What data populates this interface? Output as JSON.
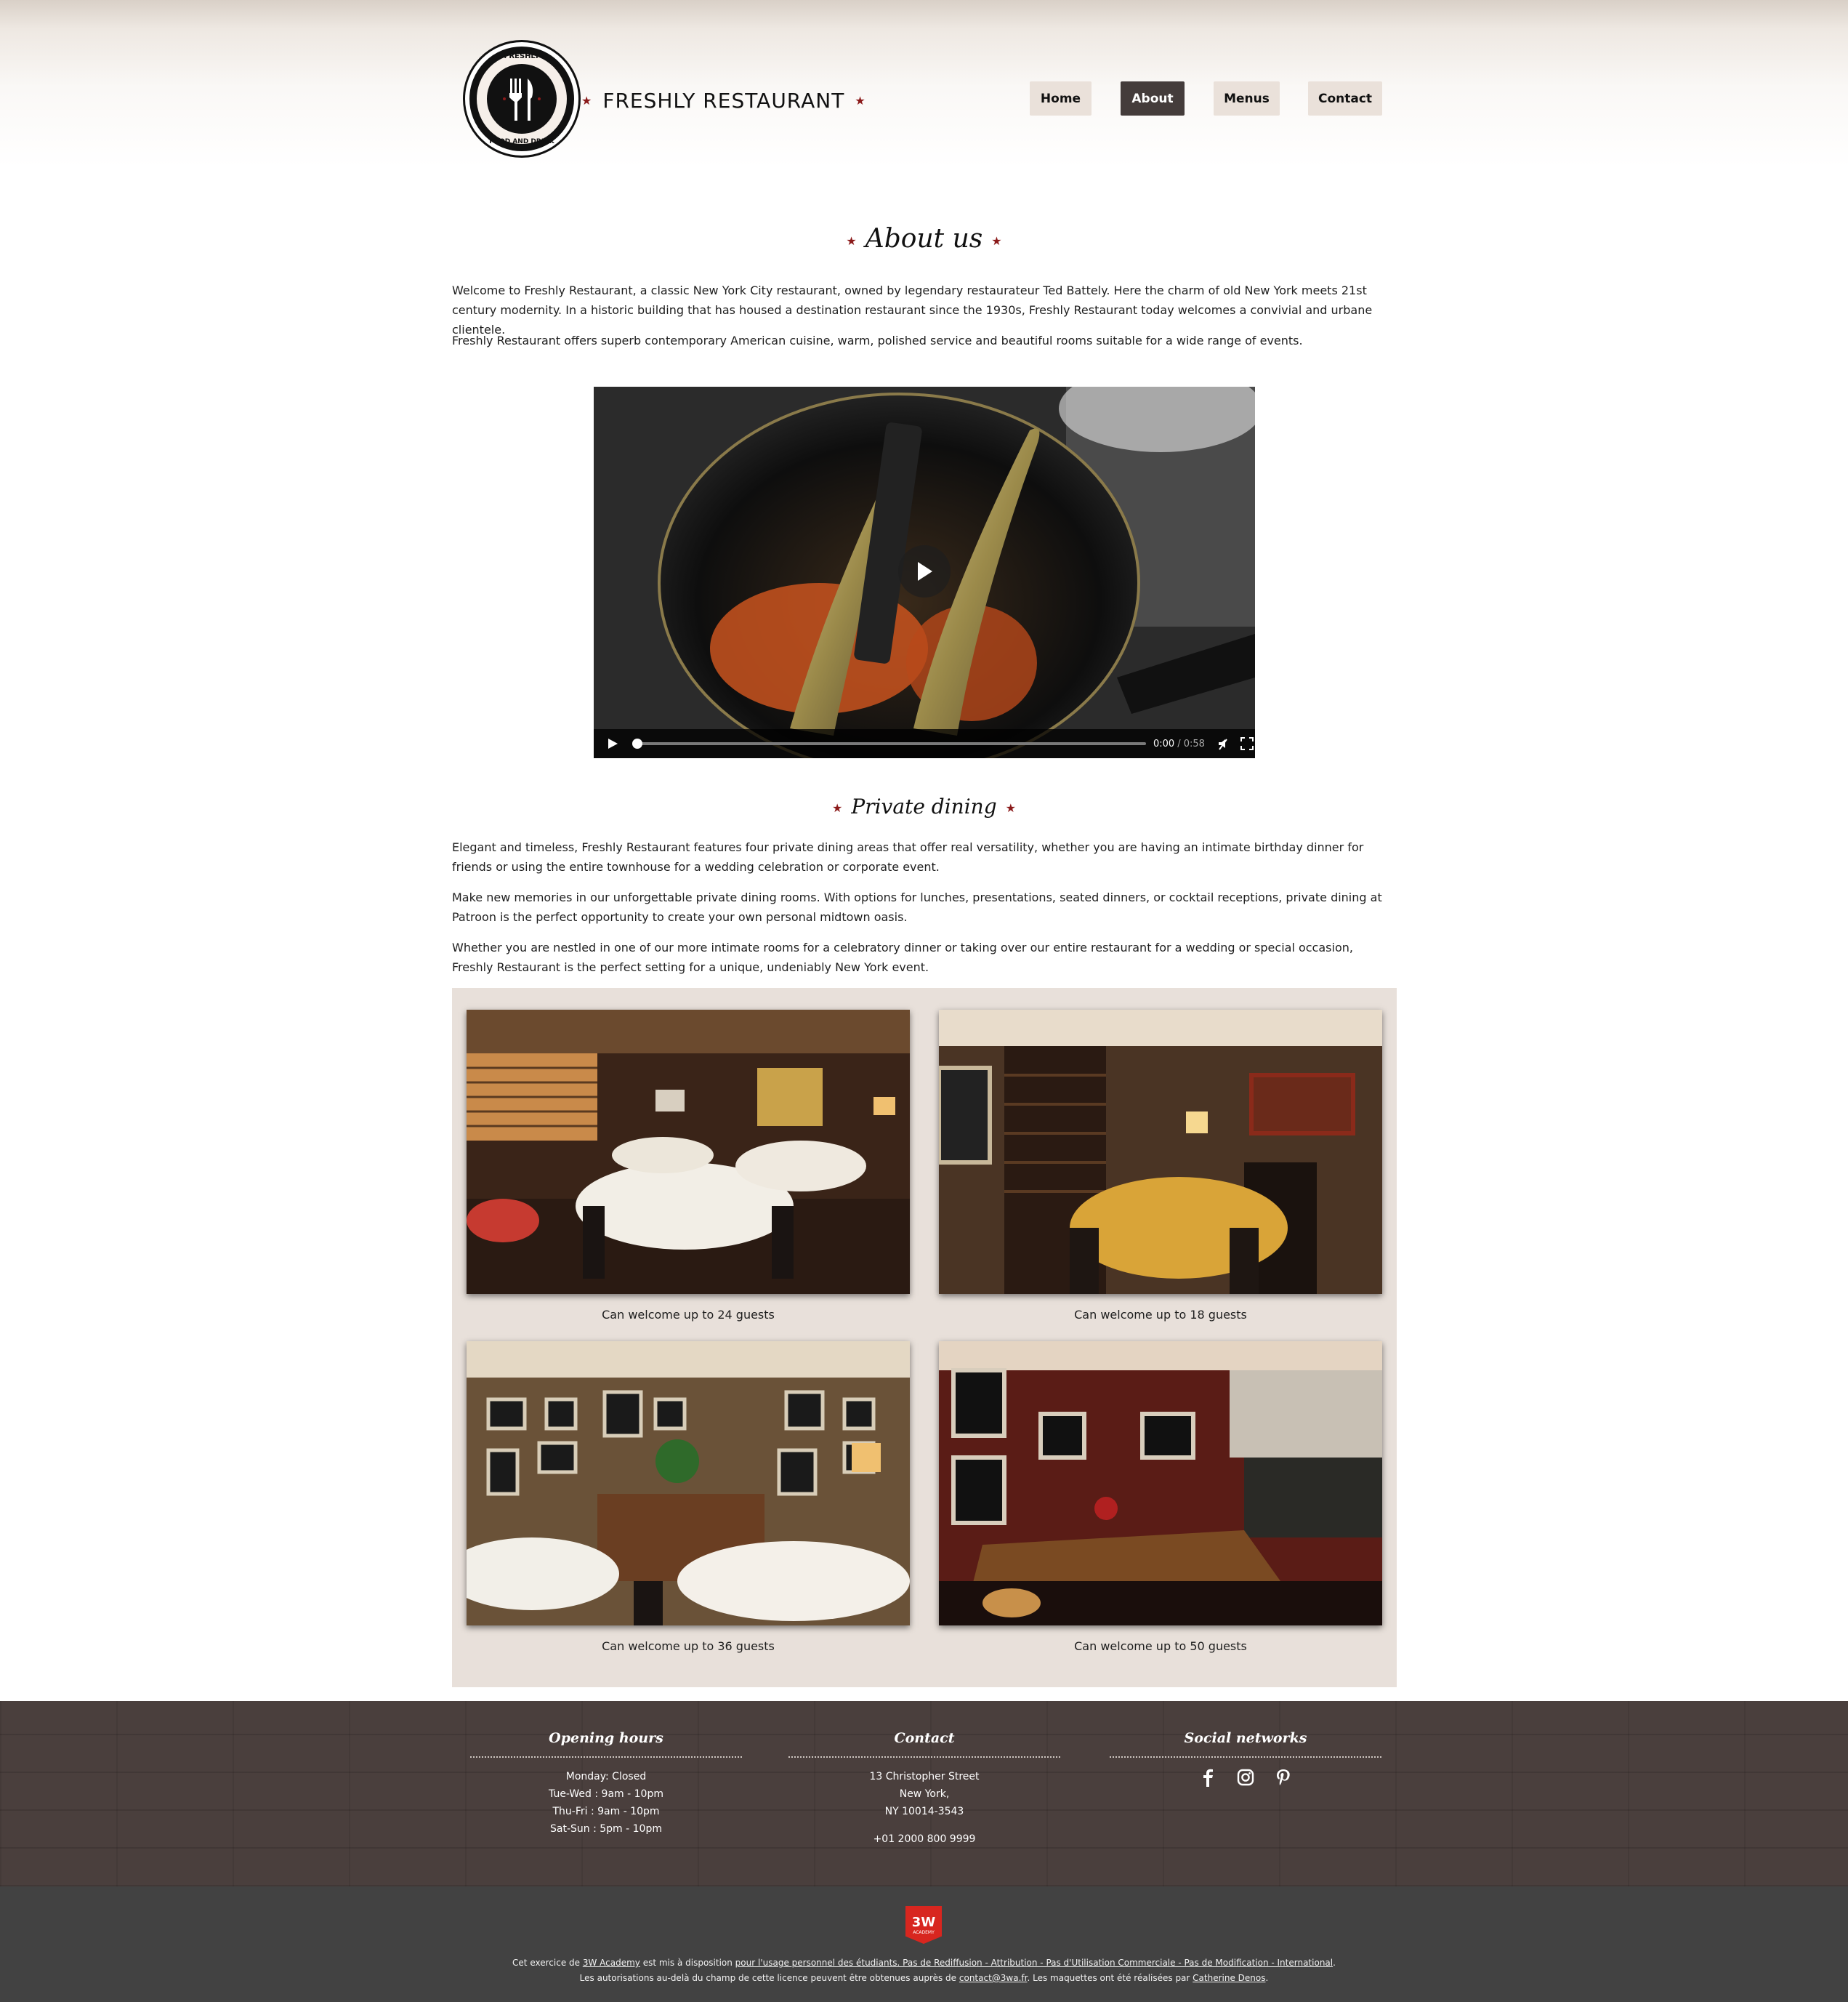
{
  "header": {
    "logo": {
      "top_text": "FRESHLY",
      "bottom_text": "FOOD AND DRINK"
    },
    "brand": "FRESHLY RESTAURANT",
    "nav": [
      "Home",
      "About",
      "Menus",
      "Contact"
    ],
    "active_nav": "About"
  },
  "about": {
    "title": "About us",
    "paragraphs": [
      "Welcome to Freshly Restaurant, a classic New York City restaurant, owned by legendary restaurateur Ted Battely. Here the charm of old New York meets 21st century modernity. In a historic building that has housed a destination restaurant since the 1930s, Freshly Restaurant today welcomes a convivial and urbane clientele.",
      "Freshly Restaurant offers superb contemporary American cuisine, warm, polished service and beautiful rooms suitable for a wide range of events."
    ]
  },
  "video": {
    "current": "0:00",
    "duration": "/ 0:58",
    "progress": 0.0
  },
  "private": {
    "title": "Private dining",
    "paragraphs": [
      "Elegant and timeless, Freshly Restaurant features four private dining areas that offer real versatility, whether you are having an intimate birthday dinner for friends or using the entire townhouse for a wedding celebration or corporate event.",
      "Make new memories in our unforgettable private dining rooms. With options for lunches, presentations, seated dinners, or cocktail receptions, private dining at Patroon is the perfect opportunity to create your own personal midtown oasis.",
      "Whether you are nestled in one of our more intimate rooms for a celebratory dinner or taking over our entire restaurant for a wedding or special occasion, Freshly Restaurant is the perfect setting for a unique, undeniably New York event."
    ],
    "rooms": [
      {
        "caption": "Can welcome up to 24 guests"
      },
      {
        "caption": "Can welcome up to 18 guests"
      },
      {
        "caption": "Can welcome up to 36 guests"
      },
      {
        "caption": "Can welcome up to 50 guests"
      }
    ]
  },
  "footer": {
    "hours": {
      "title": "Opening hours",
      "lines": [
        "Monday: Closed",
        "Tue-Wed : 9am - 10pm",
        "Thu-Fri : 9am - 10pm",
        "Sat-Sun : 5pm - 10pm"
      ]
    },
    "contact": {
      "title": "Contact",
      "lines": [
        "13 Christopher Street",
        "New York,",
        "NY 10014-3543"
      ],
      "phone": "+01 2000 800 9999"
    },
    "social": {
      "title": "Social networks",
      "icons": [
        "facebook-icon",
        "instagram-icon",
        "pinterest-icon"
      ]
    }
  },
  "legal": {
    "badge": "3W",
    "badge_sub": "ACADEMY",
    "line1_a": "Cet exercice de ",
    "line1_link1": "3W Academy",
    "line1_b": " est mis à disposition ",
    "line1_link2": "pour l'usage personnel des étudiants. Pas de Rediffusion - Attribution - Pas d'Utilisation Commerciale - Pas de Modification - International",
    "line1_c": ".",
    "line2_a": "Les autorisations au-delà du champ de cette licence peuvent être obtenues auprès de ",
    "line2_link1": "contact@3wa.fr",
    "line2_b": ". Les maquettes ont été réalisées par ",
    "line2_link2": "Catherine Denos",
    "line2_c": "."
  },
  "colors": {
    "accent": "#8b1a1a",
    "nav_active": "#443c3b",
    "nav_bg": "#eae1da",
    "footer": "#4a3f3d",
    "bottom": "#424242",
    "gallery_bg": "#e8e0da"
  }
}
